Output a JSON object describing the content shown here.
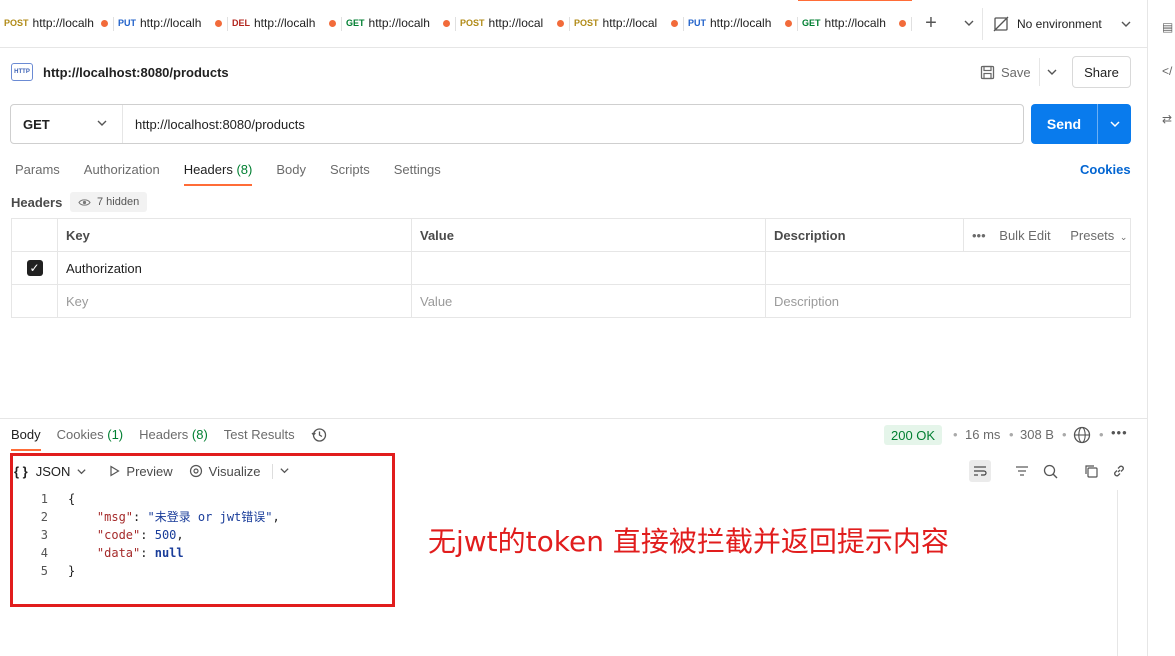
{
  "tabs": [
    {
      "method": "POST",
      "url": "http://localh",
      "active": false
    },
    {
      "method": "PUT",
      "url": "http://localh",
      "active": false
    },
    {
      "method": "DEL",
      "url": "http://localh",
      "active": false
    },
    {
      "method": "GET",
      "url": "http://localh",
      "active": false
    },
    {
      "method": "POST",
      "url": "http://local",
      "active": false
    },
    {
      "method": "POST",
      "url": "http://local",
      "active": false
    },
    {
      "method": "PUT",
      "url": "http://localh",
      "active": false
    },
    {
      "method": "GET",
      "url": "http://localh",
      "active": true
    }
  ],
  "environment": "No environment",
  "request": {
    "title": "http://localhost:8080/products",
    "save_label": "Save",
    "share_label": "Share",
    "method": "GET",
    "url": "http://localhost:8080/products",
    "send_label": "Send"
  },
  "request_tabs": [
    {
      "label": "Params",
      "count": ""
    },
    {
      "label": "Authorization",
      "count": ""
    },
    {
      "label": "Headers",
      "count": "(8)"
    },
    {
      "label": "Body",
      "count": ""
    },
    {
      "label": "Scripts",
      "count": ""
    },
    {
      "label": "Settings",
      "count": ""
    }
  ],
  "cookies_label": "Cookies",
  "headers_section": {
    "label": "Headers",
    "hidden_label": "7 hidden",
    "columns": {
      "key": "Key",
      "value": "Value",
      "description": "Description"
    },
    "bulk_edit": "Bulk Edit",
    "presets": "Presets",
    "rows": [
      {
        "checked": true,
        "key": "Authorization",
        "value": "",
        "description": ""
      }
    ],
    "placeholder": {
      "key": "Key",
      "value": "Value",
      "description": "Description"
    }
  },
  "response_tabs": [
    {
      "label": "Body",
      "count": ""
    },
    {
      "label": "Cookies",
      "count": "(1)"
    },
    {
      "label": "Headers",
      "count": "(8)"
    },
    {
      "label": "Test Results",
      "count": ""
    }
  ],
  "response": {
    "status": "200 OK",
    "time": "16 ms",
    "size": "308 B",
    "format": "JSON",
    "preview_label": "Preview",
    "visualize_label": "Visualize",
    "lines": [
      {
        "n": "1",
        "text": "{"
      },
      {
        "n": "2",
        "key": "\"msg\"",
        "value": "\"未登录 or jwt错误\"",
        "tail": ","
      },
      {
        "n": "3",
        "key": "\"code\"",
        "value": "500",
        "tail": ","
      },
      {
        "n": "4",
        "key": "\"data\"",
        "value": "null",
        "tail": ""
      },
      {
        "n": "5",
        "text": "}"
      }
    ]
  },
  "annotation": "无jwt的token  直接被拦截并返回提示内容",
  "colors": {
    "accent": "#ff6c37",
    "send": "#097bed",
    "annotation": "#e11d1d",
    "status_ok": "#007f31"
  }
}
